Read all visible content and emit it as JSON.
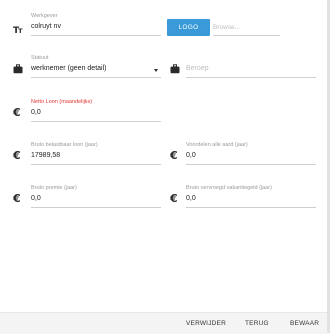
{
  "form": {
    "werkgever": {
      "label": "Werkgever",
      "value": "colruyt nv"
    },
    "logo": {
      "button_label": "LOGO",
      "browse_placeholder": "Browse..."
    },
    "statuut": {
      "label": "Statuut",
      "value": "werknemer (geen detail)"
    },
    "beroep": {
      "placeholder": "Beroep"
    },
    "netto_loon": {
      "label": "Netto Loon (maandelijks)",
      "value": "0,0"
    },
    "bruto_belastbaar_loon": {
      "label": "Bruto belastbaar loon (jaar)",
      "value": "17989,58"
    },
    "voordelen_alle_aard": {
      "label": "Voordelen alle aard (jaar)",
      "value": "0,0"
    },
    "bruto_premie": {
      "label": "Bruto premie (jaar)",
      "value": "0,0"
    },
    "bruto_vervroegd_vakantiegeld": {
      "label": "Bruto vervroegd vakantiegeld (jaar)",
      "value": "0,0"
    }
  },
  "footer": {
    "delete_label": "VERWIJDER",
    "back_label": "TERUG",
    "save_label": "BEWAAR"
  },
  "icons": {
    "text": "text-format-icon",
    "briefcase": "briefcase-icon",
    "euro": "euro-icon"
  },
  "colors": {
    "accent": "#3a9ad9",
    "error_label": "#e53935",
    "footer_bg": "#f4f4f4"
  }
}
